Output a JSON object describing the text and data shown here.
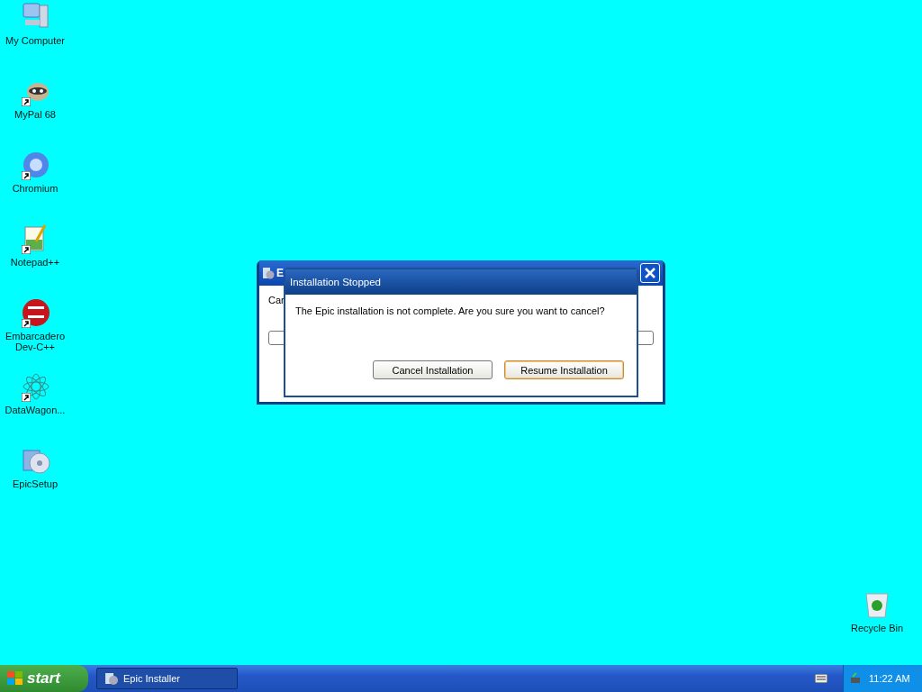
{
  "desktop_icons": [
    {
      "label": "My Computer",
      "shortcut": false
    },
    {
      "label": "MyPal 68",
      "shortcut": true
    },
    {
      "label": "Chromium",
      "shortcut": true
    },
    {
      "label": "Notepad++",
      "shortcut": true
    },
    {
      "label": "Embarcadero Dev-C++",
      "shortcut": true
    },
    {
      "label": "DataWagon...",
      "shortcut": true
    },
    {
      "label": "EpicSetup",
      "shortcut": false
    }
  ],
  "recycle_bin": {
    "label": "Recycle Bin"
  },
  "installer_window": {
    "title": "E",
    "text": "Car",
    "level": 0
  },
  "dialog": {
    "title": "Installation Stopped",
    "message": "The Epic installation is not complete. Are you sure you want to cancel?",
    "buttons": [
      {
        "label": "Cancel Installation",
        "focused": false
      },
      {
        "label": "Resume Installation",
        "focused": true
      }
    ]
  },
  "taskbar": {
    "start": "start",
    "tasks": [
      {
        "label": "Epic Installer"
      }
    ],
    "clock": "11:22 AM"
  }
}
